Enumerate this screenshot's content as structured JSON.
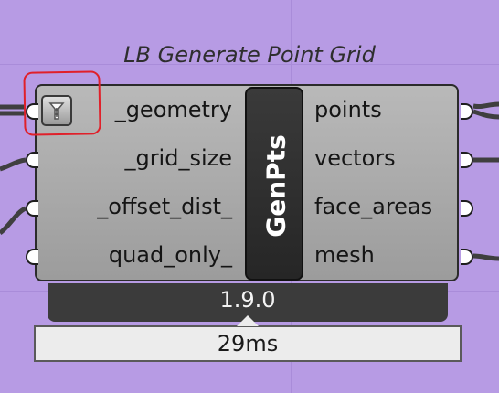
{
  "component": {
    "title": "LB Generate Point Grid",
    "nickname": "GenPts",
    "version": "1.9.0",
    "timing": "29ms",
    "inputs": [
      "_geometry",
      "_grid_size",
      "_offset_dist_",
      "quad_only_"
    ],
    "outputs": [
      "points",
      "vectors",
      "face_areas",
      "mesh"
    ]
  },
  "colors": {
    "canvas": "#b79be4",
    "annotation": "#e0202a"
  },
  "icons": {
    "geometry_param": "geometry-hide-icon"
  }
}
